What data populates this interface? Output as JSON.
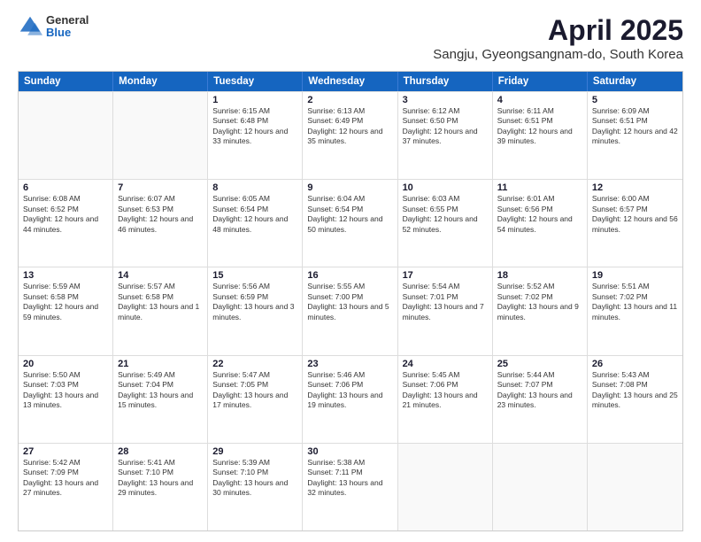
{
  "header": {
    "logo": {
      "general": "General",
      "blue": "Blue"
    },
    "title": "April 2025",
    "subtitle": "Sangju, Gyeongsangnam-do, South Korea"
  },
  "calendar": {
    "days": [
      "Sunday",
      "Monday",
      "Tuesday",
      "Wednesday",
      "Thursday",
      "Friday",
      "Saturday"
    ],
    "rows": [
      [
        {
          "day": "",
          "empty": true
        },
        {
          "day": "",
          "empty": true
        },
        {
          "day": "1",
          "sunrise": "Sunrise: 6:15 AM",
          "sunset": "Sunset: 6:48 PM",
          "daylight": "Daylight: 12 hours and 33 minutes."
        },
        {
          "day": "2",
          "sunrise": "Sunrise: 6:13 AM",
          "sunset": "Sunset: 6:49 PM",
          "daylight": "Daylight: 12 hours and 35 minutes."
        },
        {
          "day": "3",
          "sunrise": "Sunrise: 6:12 AM",
          "sunset": "Sunset: 6:50 PM",
          "daylight": "Daylight: 12 hours and 37 minutes."
        },
        {
          "day": "4",
          "sunrise": "Sunrise: 6:11 AM",
          "sunset": "Sunset: 6:51 PM",
          "daylight": "Daylight: 12 hours and 39 minutes."
        },
        {
          "day": "5",
          "sunrise": "Sunrise: 6:09 AM",
          "sunset": "Sunset: 6:51 PM",
          "daylight": "Daylight: 12 hours and 42 minutes."
        }
      ],
      [
        {
          "day": "6",
          "sunrise": "Sunrise: 6:08 AM",
          "sunset": "Sunset: 6:52 PM",
          "daylight": "Daylight: 12 hours and 44 minutes."
        },
        {
          "day": "7",
          "sunrise": "Sunrise: 6:07 AM",
          "sunset": "Sunset: 6:53 PM",
          "daylight": "Daylight: 12 hours and 46 minutes."
        },
        {
          "day": "8",
          "sunrise": "Sunrise: 6:05 AM",
          "sunset": "Sunset: 6:54 PM",
          "daylight": "Daylight: 12 hours and 48 minutes."
        },
        {
          "day": "9",
          "sunrise": "Sunrise: 6:04 AM",
          "sunset": "Sunset: 6:54 PM",
          "daylight": "Daylight: 12 hours and 50 minutes."
        },
        {
          "day": "10",
          "sunrise": "Sunrise: 6:03 AM",
          "sunset": "Sunset: 6:55 PM",
          "daylight": "Daylight: 12 hours and 52 minutes."
        },
        {
          "day": "11",
          "sunrise": "Sunrise: 6:01 AM",
          "sunset": "Sunset: 6:56 PM",
          "daylight": "Daylight: 12 hours and 54 minutes."
        },
        {
          "day": "12",
          "sunrise": "Sunrise: 6:00 AM",
          "sunset": "Sunset: 6:57 PM",
          "daylight": "Daylight: 12 hours and 56 minutes."
        }
      ],
      [
        {
          "day": "13",
          "sunrise": "Sunrise: 5:59 AM",
          "sunset": "Sunset: 6:58 PM",
          "daylight": "Daylight: 12 hours and 59 minutes."
        },
        {
          "day": "14",
          "sunrise": "Sunrise: 5:57 AM",
          "sunset": "Sunset: 6:58 PM",
          "daylight": "Daylight: 13 hours and 1 minute."
        },
        {
          "day": "15",
          "sunrise": "Sunrise: 5:56 AM",
          "sunset": "Sunset: 6:59 PM",
          "daylight": "Daylight: 13 hours and 3 minutes."
        },
        {
          "day": "16",
          "sunrise": "Sunrise: 5:55 AM",
          "sunset": "Sunset: 7:00 PM",
          "daylight": "Daylight: 13 hours and 5 minutes."
        },
        {
          "day": "17",
          "sunrise": "Sunrise: 5:54 AM",
          "sunset": "Sunset: 7:01 PM",
          "daylight": "Daylight: 13 hours and 7 minutes."
        },
        {
          "day": "18",
          "sunrise": "Sunrise: 5:52 AM",
          "sunset": "Sunset: 7:02 PM",
          "daylight": "Daylight: 13 hours and 9 minutes."
        },
        {
          "day": "19",
          "sunrise": "Sunrise: 5:51 AM",
          "sunset": "Sunset: 7:02 PM",
          "daylight": "Daylight: 13 hours and 11 minutes."
        }
      ],
      [
        {
          "day": "20",
          "sunrise": "Sunrise: 5:50 AM",
          "sunset": "Sunset: 7:03 PM",
          "daylight": "Daylight: 13 hours and 13 minutes."
        },
        {
          "day": "21",
          "sunrise": "Sunrise: 5:49 AM",
          "sunset": "Sunset: 7:04 PM",
          "daylight": "Daylight: 13 hours and 15 minutes."
        },
        {
          "day": "22",
          "sunrise": "Sunrise: 5:47 AM",
          "sunset": "Sunset: 7:05 PM",
          "daylight": "Daylight: 13 hours and 17 minutes."
        },
        {
          "day": "23",
          "sunrise": "Sunrise: 5:46 AM",
          "sunset": "Sunset: 7:06 PM",
          "daylight": "Daylight: 13 hours and 19 minutes."
        },
        {
          "day": "24",
          "sunrise": "Sunrise: 5:45 AM",
          "sunset": "Sunset: 7:06 PM",
          "daylight": "Daylight: 13 hours and 21 minutes."
        },
        {
          "day": "25",
          "sunrise": "Sunrise: 5:44 AM",
          "sunset": "Sunset: 7:07 PM",
          "daylight": "Daylight: 13 hours and 23 minutes."
        },
        {
          "day": "26",
          "sunrise": "Sunrise: 5:43 AM",
          "sunset": "Sunset: 7:08 PM",
          "daylight": "Daylight: 13 hours and 25 minutes."
        }
      ],
      [
        {
          "day": "27",
          "sunrise": "Sunrise: 5:42 AM",
          "sunset": "Sunset: 7:09 PM",
          "daylight": "Daylight: 13 hours and 27 minutes."
        },
        {
          "day": "28",
          "sunrise": "Sunrise: 5:41 AM",
          "sunset": "Sunset: 7:10 PM",
          "daylight": "Daylight: 13 hours and 29 minutes."
        },
        {
          "day": "29",
          "sunrise": "Sunrise: 5:39 AM",
          "sunset": "Sunset: 7:10 PM",
          "daylight": "Daylight: 13 hours and 30 minutes."
        },
        {
          "day": "30",
          "sunrise": "Sunrise: 5:38 AM",
          "sunset": "Sunset: 7:11 PM",
          "daylight": "Daylight: 13 hours and 32 minutes."
        },
        {
          "day": "",
          "empty": true
        },
        {
          "day": "",
          "empty": true
        },
        {
          "day": "",
          "empty": true
        }
      ]
    ]
  }
}
